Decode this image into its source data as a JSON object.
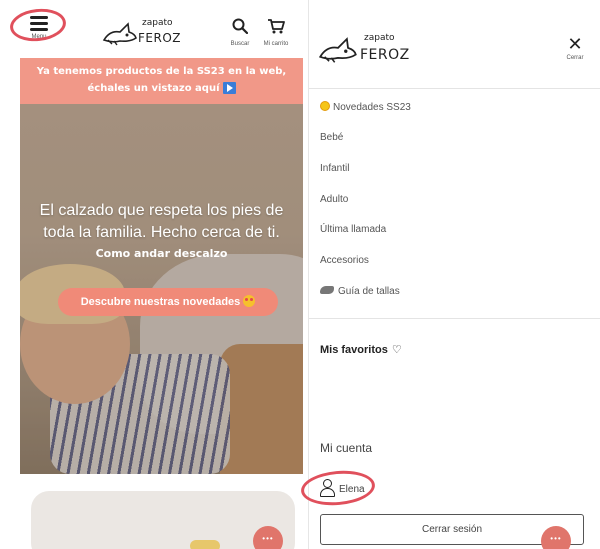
{
  "left": {
    "header": {
      "menu_label": "Menu",
      "logo_top": "zapato",
      "logo_bottom": "FEROZ",
      "search_label": "Buscar",
      "cart_label": "Mi carrito"
    },
    "promo": {
      "line1": "Ya tenemos productos de la SS23 en la web,",
      "line2": "échales un vistazo aquí"
    },
    "hero": {
      "title": "El calzado que respeta los pies de toda la familia. Hecho cerca de ti.",
      "link": "Como andar descalzo",
      "cta": "Descubre nuestras novedades"
    }
  },
  "right": {
    "logo_top": "zapato",
    "logo_bottom": "FEROZ",
    "close_label": "Cerrar",
    "nav": [
      {
        "label": "Novedades SS23",
        "icon": "sun-icon"
      },
      {
        "label": "Bebé"
      },
      {
        "label": "Infantil"
      },
      {
        "label": "Adulto"
      },
      {
        "label": "Última llamada"
      },
      {
        "label": "Accesorios"
      },
      {
        "label": "Guía de tallas",
        "icon": "shoe-icon"
      }
    ],
    "favorites_title": "Mis favoritos",
    "account_title": "Mi cuenta",
    "user_name": "Elena",
    "logout_label": "Cerrar sesión"
  },
  "colors": {
    "promo_bg": "#f19888",
    "cta_bg": "#f08a78",
    "annotation": "#e0505c",
    "chat_bg": "#e0756b"
  }
}
